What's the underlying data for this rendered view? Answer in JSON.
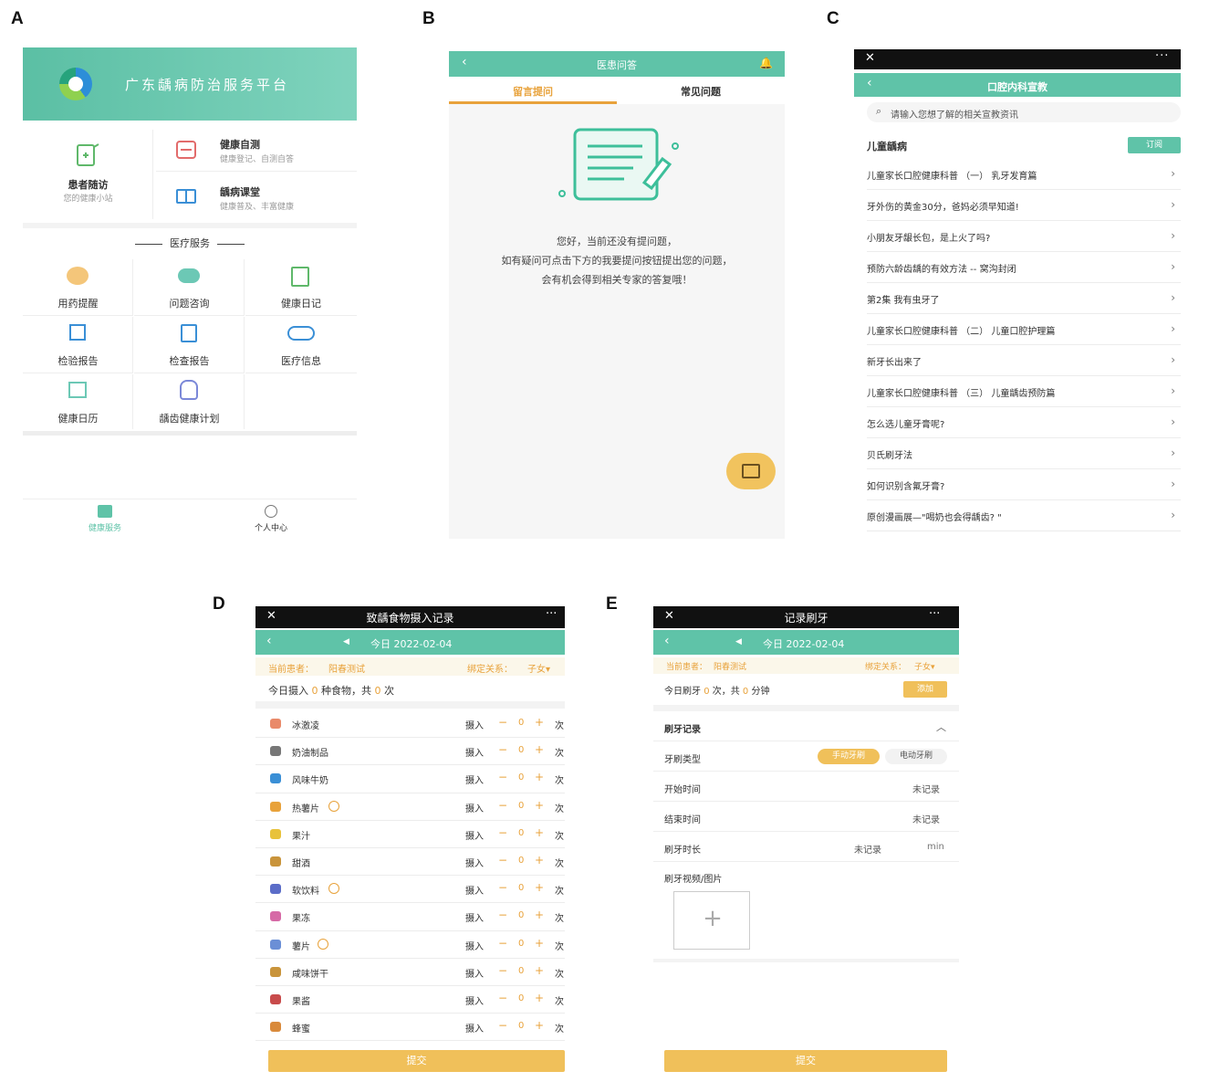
{
  "panel_labels": [
    "A",
    "B",
    "C",
    "D",
    "E"
  ],
  "panelA": {
    "banner_title": "广东龋病防治服务平台",
    "followup": {
      "title": "患者随访",
      "subtitle": "您的健康小站"
    },
    "self_test": {
      "title": "健康自测",
      "subtitle": "健康登记、自测自答"
    },
    "classroom": {
      "title": "龋病课堂",
      "subtitle": "健康普及、丰富健康"
    },
    "section_title": "医疗服务",
    "grid": [
      "用药提醒",
      "问题咨询",
      "健康日记",
      "检验报告",
      "检查报告",
      "医疗信息",
      "健康日历",
      "龋齿健康计划"
    ],
    "nav": {
      "health": "健康服务",
      "personal": "个人中心"
    }
  },
  "panelB": {
    "title": "医患问答",
    "tabs": [
      "留言提问",
      "常见问题"
    ],
    "message": [
      "您好，当前还没有提问题，",
      "如有疑问可点击下方的我要提问按钮提出您的问题，",
      "会有机会得到相关专家的答复哦！"
    ]
  },
  "panelC": {
    "title": "口腔内科宣教",
    "search_placeholder": "请输入您想了解的相关宣教资讯",
    "category": "儿童龋病",
    "subscribe": "订阅",
    "articles": [
      "儿童家长口腔健康科普 （一） 乳牙发育篇",
      "牙外伤的黄金30分，爸妈必须早知道!",
      "小朋友牙龈长包，是上火了吗?",
      "预防六龄齿龋的有效方法 -- 窝沟封闭",
      "第2集 我有虫牙了",
      "儿童家长口腔健康科普 （二） 儿童口腔护理篇",
      "新牙长出来了",
      "儿童家长口腔健康科普 （三） 儿童龋齿预防篇",
      "怎么选儿童牙膏呢?",
      "贝氏刷牙法",
      "如何识别含氟牙膏?",
      "原创漫画展—\"喝奶也会得龋齿? \""
    ]
  },
  "panelD": {
    "title": "致龋食物摄入记录",
    "date": "今日 2022-02-04",
    "patient_label": "当前患者：",
    "patient_name": "阳春测试",
    "relation_label": "绑定关系：",
    "relation_value": "子女",
    "summary": [
      "今日摄入 ",
      "0",
      " 种食物，共 ",
      "0",
      " 次"
    ],
    "intake_label": "摄入",
    "count": "0",
    "unit": "次",
    "foods": [
      "冰激凌",
      "奶油制品",
      "风味牛奶",
      "热薯片",
      "果汁",
      "甜酒",
      "软饮料",
      "果冻",
      "薯片",
      "咸味饼干",
      "果酱",
      "蜂蜜"
    ],
    "submit": "提交"
  },
  "panelE": {
    "title": "记录刷牙",
    "date": "今日 2022-02-04",
    "patient_label": "当前患者：",
    "patient_name": "阳春测试",
    "relation_label": "绑定关系：",
    "relation_value": "子女",
    "summary": [
      "今日刷牙 ",
      "0",
      " 次，共 ",
      "0",
      " 分钟"
    ],
    "add": "添加",
    "section": "刷牙记录",
    "brush_type_label": "牙刷类型",
    "brush_manual": "手动牙刷",
    "brush_electric": "电动牙刷",
    "start_label": "开始时间",
    "start_value": "未记录",
    "end_label": "结束时间",
    "end_value": "未记录",
    "duration_label": "刷牙时长",
    "duration_value": "未记录",
    "duration_unit": "min",
    "media_label": "刷牙视频/图片",
    "submit": "提交"
  },
  "colors": {
    "teal": "#5fc3a8",
    "orange": "#e8a23b",
    "button": "#f0c05a"
  }
}
